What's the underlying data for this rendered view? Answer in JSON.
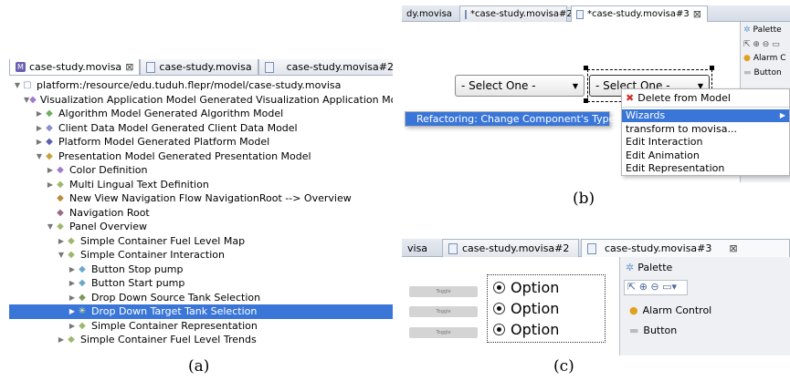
{
  "captions": {
    "a": "(a)",
    "b": "(b)",
    "c": "(c)"
  },
  "a": {
    "tabs": [
      "case-study.movisa",
      "case-study.movisa",
      "case-study.movisa#2"
    ],
    "close_glyph": "⊠",
    "tree": [
      {
        "indent": 0,
        "tw": "▼",
        "icon": "▢",
        "icon_color": "#7b8fb0",
        "label": "platform:/resource/edu.tuduh.flepr/model/case-study.movisa"
      },
      {
        "indent": 1,
        "tw": "▼",
        "icon": "◆",
        "icon_color": "#a07ad0",
        "label": "Visualization Application Model Generated Visualization Application Model"
      },
      {
        "indent": 2,
        "tw": "▶",
        "icon": "◆",
        "icon_color": "#6fae5e",
        "label": "Algorithm Model Generated Algorithm Model"
      },
      {
        "indent": 2,
        "tw": "▶",
        "icon": "◆",
        "icon_color": "#8a8fd0",
        "label": "Client Data Model Generated Client Data Model"
      },
      {
        "indent": 2,
        "tw": "▶",
        "icon": "◆",
        "icon_color": "#5a5fb0",
        "label": "Platform Model Generated Platform Model"
      },
      {
        "indent": 2,
        "tw": "▼",
        "icon": "◆",
        "icon_color": "#c9a13a",
        "label": "Presentation Model Generated Presentation Model"
      },
      {
        "indent": 3,
        "tw": "▶",
        "icon": "◆",
        "icon_color": "#a07ad0",
        "label": "Color Definition"
      },
      {
        "indent": 3,
        "tw": "▶",
        "icon": "◆",
        "icon_color": "#9db86e",
        "label": "Multi Lingual Text Definition"
      },
      {
        "indent": 3,
        "tw": "",
        "icon": "◆",
        "icon_color": "#b98a3a",
        "label": "New View Navigation Flow NavigationRoot --> Overview"
      },
      {
        "indent": 3,
        "tw": "",
        "icon": "◆",
        "icon_color": "#9a6a8a",
        "label": "Navigation Root"
      },
      {
        "indent": 3,
        "tw": "▼",
        "icon": "◆",
        "icon_color": "#9db86e",
        "label": "Panel Overview"
      },
      {
        "indent": 4,
        "tw": "▶",
        "icon": "◆",
        "icon_color": "#9db86e",
        "label": "Simple Container Fuel Level Map"
      },
      {
        "indent": 4,
        "tw": "▼",
        "icon": "◆",
        "icon_color": "#9db86e",
        "label": "Simple Container Interaction"
      },
      {
        "indent": 5,
        "tw": "▶",
        "icon": "◆",
        "icon_color": "#6aa8d0",
        "label": "Button Stop pump"
      },
      {
        "indent": 5,
        "tw": "▶",
        "icon": "◆",
        "icon_color": "#6aa8d0",
        "label": "Button Start pump"
      },
      {
        "indent": 5,
        "tw": "▶",
        "icon": "◆",
        "icon_color": "#7a9a5a",
        "label": "Drop Down Source Tank Selection"
      },
      {
        "indent": 5,
        "tw": "▶",
        "icon": "✳",
        "icon_color": "#e8f0a0",
        "label": "Drop Down Target Tank Selection",
        "selected": true
      },
      {
        "indent": 5,
        "tw": "▶",
        "icon": "◆",
        "icon_color": "#9db86e",
        "label": "Simple Container Representation"
      },
      {
        "indent": 4,
        "tw": "▶",
        "icon": "◆",
        "icon_color": "#9db86e",
        "label": "Simple Container Fuel Level Trends"
      }
    ]
  },
  "b": {
    "tabs": {
      "first": "dy.movisa",
      "second": "*case-study.movisa#2",
      "third": "*case-study.movisa#3"
    },
    "close_glyph": "⊠",
    "palette": {
      "title": "Palette",
      "items": [
        "Alarm C",
        "Button"
      ]
    },
    "dropdown_left": "- Select One -",
    "dropdown_right": "- Select One -",
    "left_menu": "Refactoring: Change Component's Type.",
    "context_menu": {
      "delete": "Delete from Model",
      "wizards": "Wizards",
      "items": [
        "transform to movisa...",
        "Edit Interaction",
        "Edit Animation",
        "Edit Representation"
      ]
    }
  },
  "c": {
    "tabs": {
      "first": "visa",
      "second": "case-study.movisa#2",
      "third": "case-study.movisa#3"
    },
    "close_glyph": "⊠",
    "toggle_label": "Toggle",
    "options": [
      "Option",
      "Option",
      "Option"
    ],
    "palette": {
      "title": "Palette",
      "items": [
        "Alarm Control",
        "Button"
      ]
    }
  },
  "colors": {
    "selection": "#3a76d8",
    "delete_x": "#d0312d",
    "alarm": "#e0a020"
  }
}
